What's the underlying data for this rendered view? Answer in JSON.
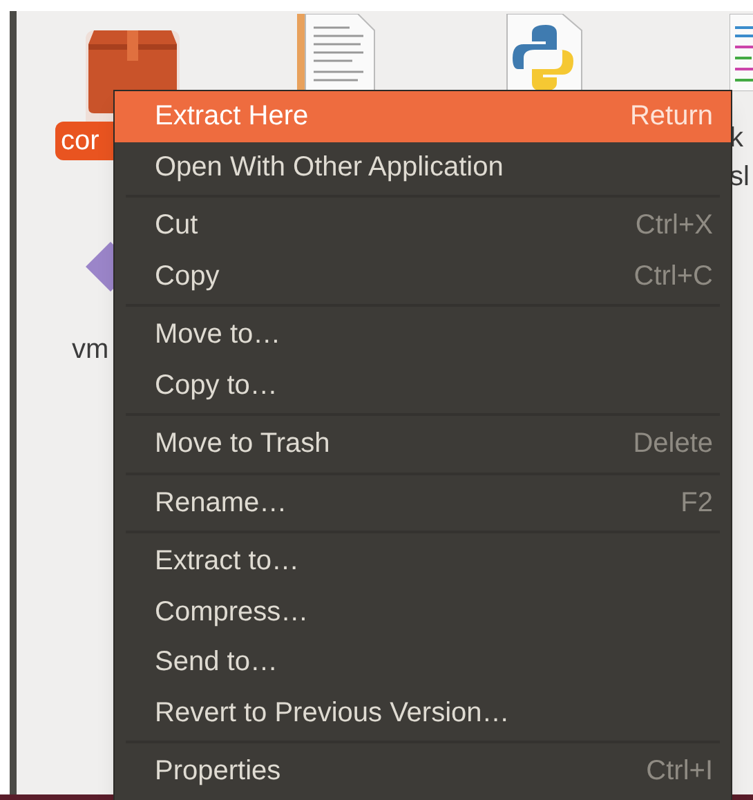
{
  "files": [
    {
      "kind": "archive",
      "label": "cor",
      "selected": true
    },
    {
      "kind": "text",
      "selected": false
    },
    {
      "kind": "python",
      "selected": false
    },
    {
      "kind": "code",
      "label": "k",
      "label_2": "sl",
      "selected": false
    },
    {
      "kind": "vm",
      "label": "vm",
      "selected": false
    }
  ],
  "menu": {
    "sections": [
      [
        {
          "label": "Extract Here",
          "shortcut": "Return",
          "selected": true
        },
        {
          "label": "Open With Other Application",
          "selected": false
        }
      ],
      [
        {
          "label": "Cut",
          "shortcut": "Ctrl+X",
          "selected": false
        },
        {
          "label": "Copy",
          "shortcut": "Ctrl+C",
          "selected": false
        }
      ],
      [
        {
          "label": "Move to…",
          "selected": false
        },
        {
          "label": "Copy to…",
          "selected": false
        }
      ],
      [
        {
          "label": "Move to Trash",
          "shortcut": "Delete",
          "selected": false
        }
      ],
      [
        {
          "label": "Rename…",
          "shortcut": "F2",
          "selected": false
        }
      ],
      [
        {
          "label": "Extract to…",
          "selected": false
        },
        {
          "label": "Compress…",
          "selected": false
        },
        {
          "label": "Send to…",
          "selected": false
        },
        {
          "label": "Revert to Previous Version…",
          "selected": false
        }
      ],
      [
        {
          "label": "Properties",
          "shortcut": "Ctrl+I",
          "selected": false
        }
      ]
    ]
  }
}
